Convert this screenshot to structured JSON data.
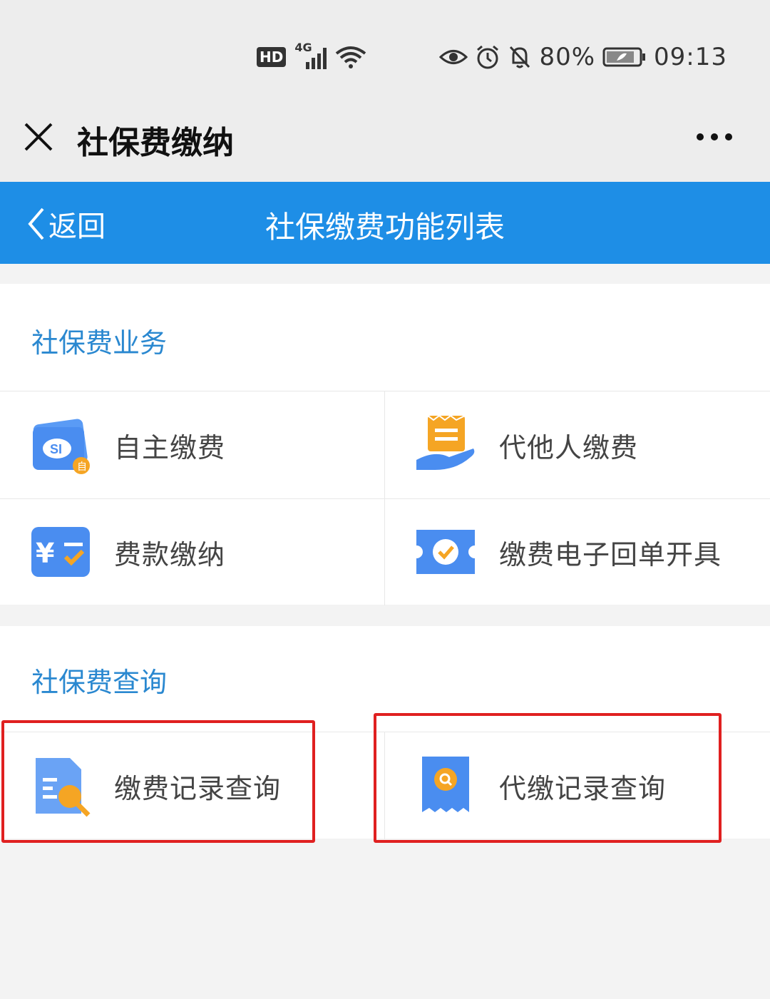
{
  "status_bar": {
    "hd": "HD",
    "network": "4G",
    "battery_percent": "80%",
    "time": "09:13"
  },
  "title_bar": {
    "title": "社保费缴纳"
  },
  "nav_bar": {
    "back_label": "返回",
    "title": "社保缴费功能列表"
  },
  "section_business": {
    "title": "社保费业务",
    "items": [
      {
        "label": "自主缴费",
        "icon": "si-card-icon"
      },
      {
        "label": "代他人缴费",
        "icon": "hand-receipt-icon"
      },
      {
        "label": "费款缴纳",
        "icon": "yuan-check-icon"
      },
      {
        "label": "缴费电子回单开具",
        "icon": "ticket-check-icon"
      }
    ]
  },
  "section_query": {
    "title": "社保费查询",
    "items": [
      {
        "label": "缴费记录查询",
        "icon": "document-search-icon"
      },
      {
        "label": "代缴记录查询",
        "icon": "receipt-search-icon"
      }
    ]
  },
  "colors": {
    "nav_blue": "#1e8ee6",
    "section_title_blue": "#2a88d0",
    "highlight_red": "#e02020"
  }
}
